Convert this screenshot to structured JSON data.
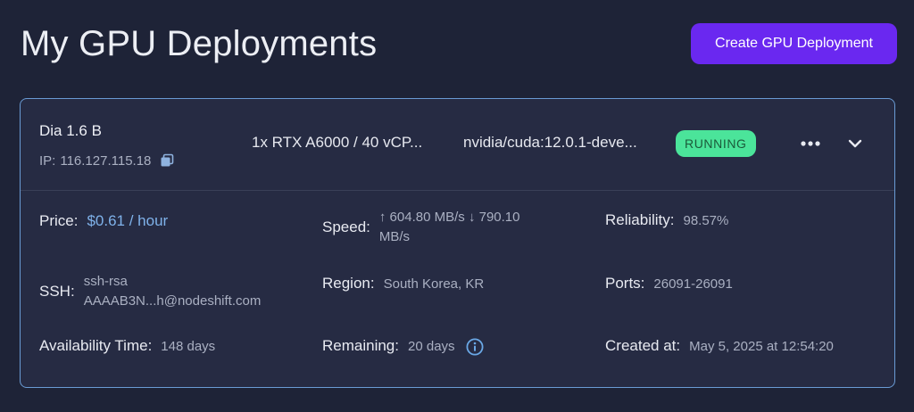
{
  "header": {
    "title": "My GPU Deployments",
    "create_button_label": "Create GPU Deployment"
  },
  "deployment": {
    "name": "Dia 1.6 B",
    "ip_label": "IP:",
    "ip": "116.127.115.18",
    "gpu_config": "1x RTX A6000 / 40 vCP...",
    "image": "nvidia/cuda:12.0.1-deve...",
    "status": "RUNNING",
    "details": {
      "price_label": "Price:",
      "price_value": "$0.61 / hour",
      "speed_label": "Speed:",
      "speed_line1": "↑ 604.80 MB/s ↓ 790.10",
      "speed_line2": "MB/s",
      "reliability_label": "Reliability:",
      "reliability_value": "98.57%",
      "ssh_label": "SSH:",
      "ssh_line1": "ssh-rsa",
      "ssh_line2": "AAAAB3N...h@nodeshift.com",
      "region_label": "Region:",
      "region_value": "South Korea, KR",
      "ports_label": "Ports:",
      "ports_value": "26091-26091",
      "availability_label": "Availability Time:",
      "availability_value": "148 days",
      "remaining_label": "Remaining:",
      "remaining_value": "20 days",
      "created_label": "Created at:",
      "created_value": "May 5, 2025 at 12:54:20"
    }
  },
  "icons": {
    "copy": "copy-icon",
    "more": "more-horizontal-icon",
    "expand": "chevron-down-icon",
    "info": "info-icon"
  },
  "colors": {
    "background": "#1e2337",
    "card": "#262b43",
    "card_border": "#6a9bd4",
    "accent_button": "#6a28f0",
    "status_running": "#4be49a",
    "price": "#7fb2ea",
    "info_icon": "#6aa8e6"
  }
}
